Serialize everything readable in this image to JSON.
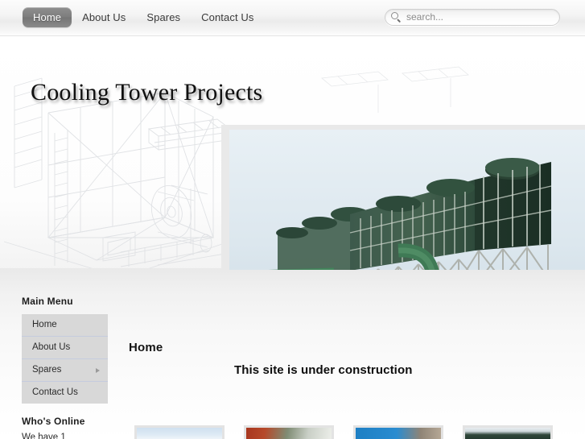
{
  "topnav": {
    "items": [
      {
        "label": "Home",
        "active": true
      },
      {
        "label": "About Us",
        "active": false
      },
      {
        "label": "Spares",
        "active": false
      },
      {
        "label": "Contact Us",
        "active": false
      }
    ]
  },
  "search": {
    "placeholder": "search...",
    "value": "",
    "icon": "search-icon"
  },
  "header": {
    "site_title": "Cooling Tower Projects",
    "hero": {
      "alt": "Green industrial cooling tower with piping",
      "dots": 7,
      "active_dot": 0
    },
    "background_art": "cooling-tower-blueprint-linework"
  },
  "sidebar": {
    "main_menu": {
      "title": "Main Menu",
      "items": [
        {
          "label": "Home",
          "has_submenu": false
        },
        {
          "label": "About Us",
          "has_submenu": false
        },
        {
          "label": "Spares",
          "has_submenu": true
        },
        {
          "label": "Contact Us",
          "has_submenu": false
        }
      ]
    },
    "whos_online": {
      "title": "Who's Online",
      "text": "We have 1"
    }
  },
  "main": {
    "page_title": "Home",
    "heading": "This site is under construction"
  },
  "thumbnails": [
    {
      "name": "thumb-1",
      "tone": "pale-blue-sky"
    },
    {
      "name": "thumb-2",
      "tone": "red-brown-industrial"
    },
    {
      "name": "thumb-3",
      "tone": "blue-tower-panels"
    },
    {
      "name": "thumb-4",
      "tone": "dark-green-tower"
    }
  ],
  "colors": {
    "nav_active_bg": "#7d7d7d",
    "menu_bg": "#d8d8d8",
    "menu_divider": "#c5ccde",
    "page_bg": "#f7f7f7",
    "text": "#2b2b2b"
  }
}
